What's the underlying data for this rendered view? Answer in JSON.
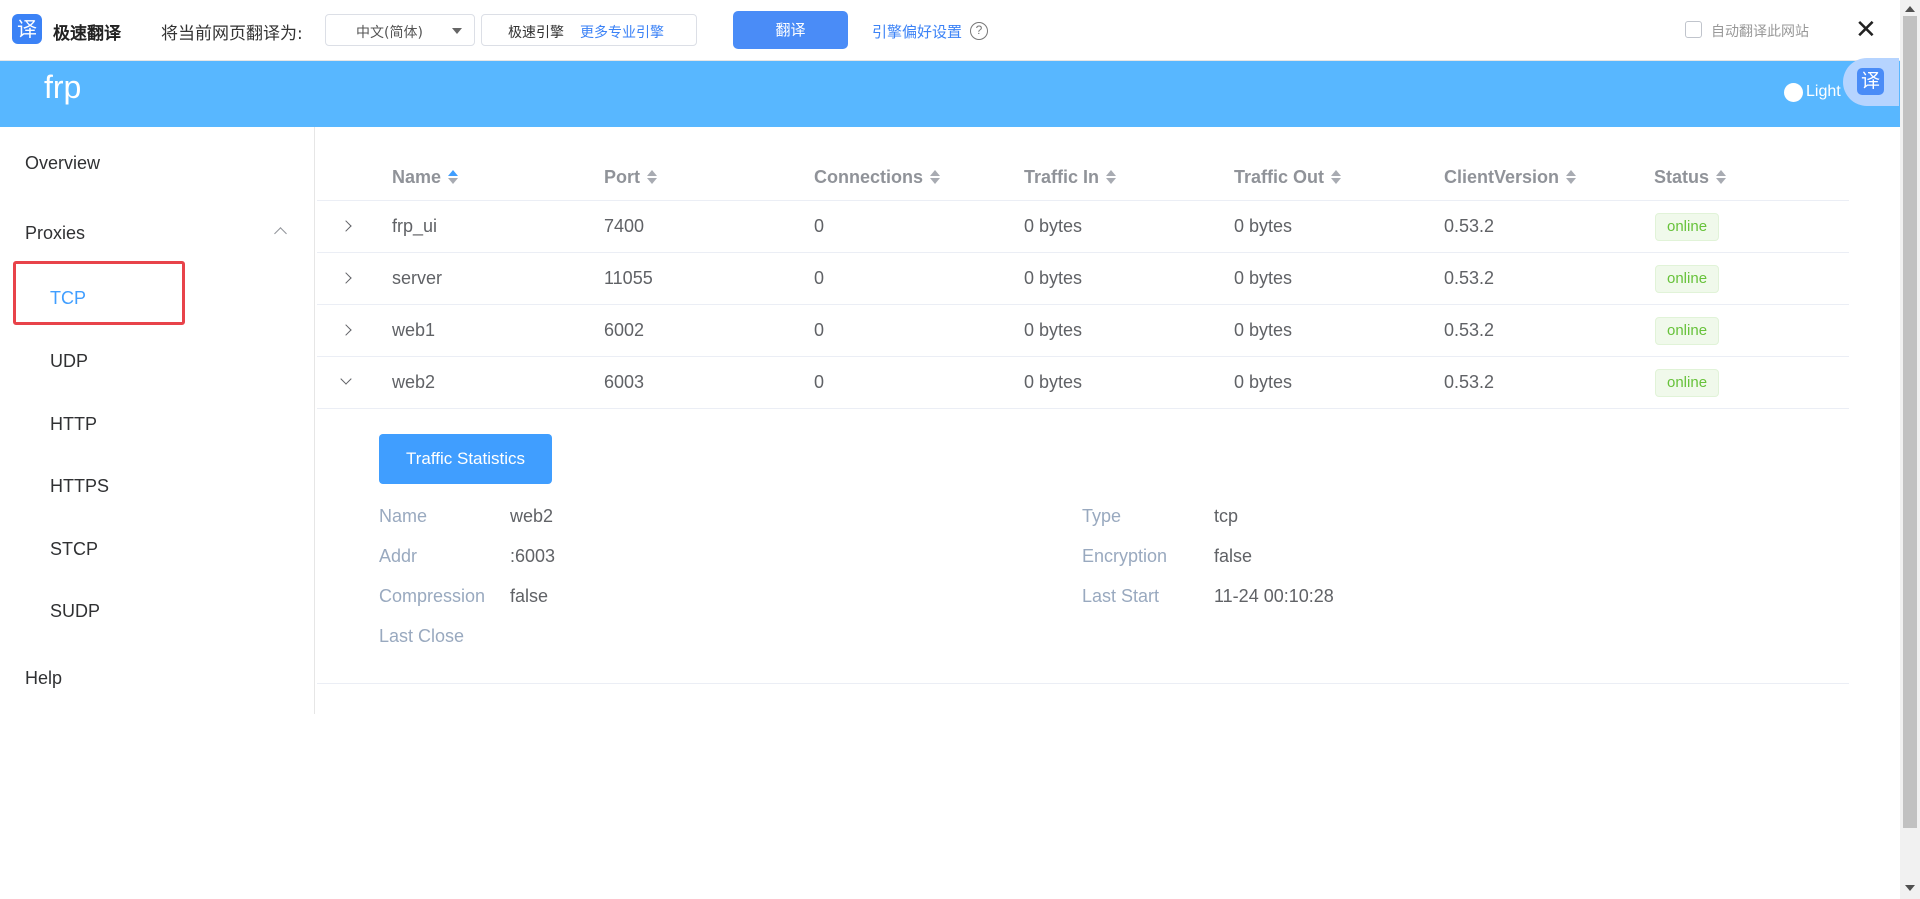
{
  "translate_bar": {
    "logo_glyph": "译",
    "brand": "极速翻译",
    "prompt": "将当前网页翻译为:",
    "language": "中文(简体)",
    "engine": "极速引擎",
    "more_engines": "更多专业引擎",
    "translate_button": "翻译",
    "preferences": "引擎偏好设置",
    "help_glyph": "?",
    "auto_translate": "自动翻译此网站",
    "close_glyph": "✕"
  },
  "header": {
    "title": "frp",
    "theme_label": "Light",
    "fab_glyph": "译",
    "color": "#58b7ff"
  },
  "sidebar": {
    "overview": "Overview",
    "proxies": "Proxies",
    "items": [
      {
        "label": "TCP",
        "active": true
      },
      {
        "label": "UDP"
      },
      {
        "label": "HTTP"
      },
      {
        "label": "HTTPS"
      },
      {
        "label": "STCP"
      },
      {
        "label": "SUDP"
      }
    ],
    "help": "Help"
  },
  "table": {
    "columns": [
      "Name",
      "Port",
      "Connections",
      "Traffic In",
      "Traffic Out",
      "ClientVersion",
      "Status"
    ],
    "rows": [
      {
        "name": "frp_ui",
        "port": "7400",
        "connections": "0",
        "traffic_in": "0 bytes",
        "traffic_out": "0 bytes",
        "client_version": "0.53.2",
        "status": "online"
      },
      {
        "name": "server",
        "port": "11055",
        "connections": "0",
        "traffic_in": "0 bytes",
        "traffic_out": "0 bytes",
        "client_version": "0.53.2",
        "status": "online"
      },
      {
        "name": "web1",
        "port": "6002",
        "connections": "0",
        "traffic_in": "0 bytes",
        "traffic_out": "0 bytes",
        "client_version": "0.53.2",
        "status": "online"
      },
      {
        "name": "web2",
        "port": "6003",
        "connections": "0",
        "traffic_in": "0 bytes",
        "traffic_out": "0 bytes",
        "client_version": "0.53.2",
        "status": "online"
      }
    ]
  },
  "detail": {
    "button": "Traffic Statistics",
    "name_label": "Name",
    "name_value": "web2",
    "addr_label": "Addr",
    "addr_value": ":6003",
    "compression_label": "Compression",
    "compression_value": "false",
    "last_close_label": "Last Close",
    "type_label": "Type",
    "type_value": "tcp",
    "encryption_label": "Encryption",
    "encryption_value": "false",
    "last_start_label": "Last Start",
    "last_start_value": "11-24 00:10:28"
  }
}
